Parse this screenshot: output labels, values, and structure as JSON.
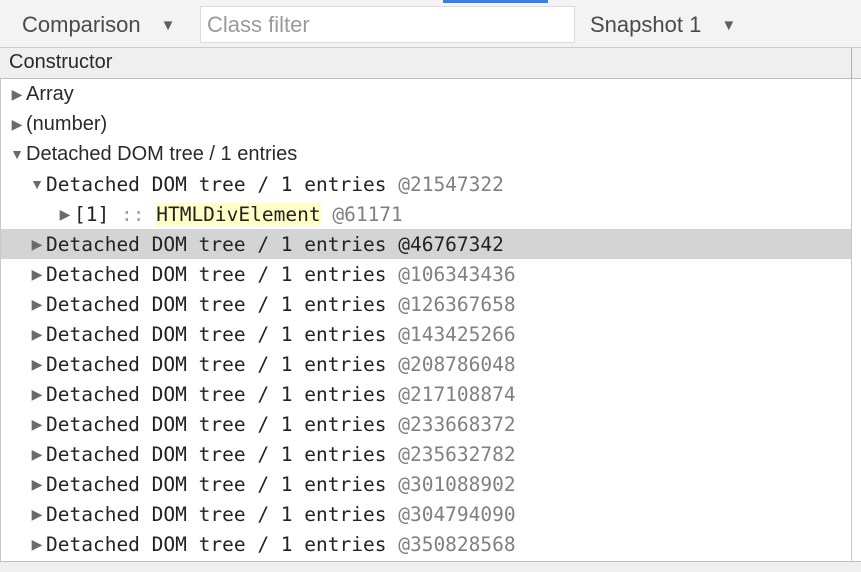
{
  "toolbar": {
    "view_mode": "Comparison",
    "class_filter_placeholder": "Class filter",
    "class_filter_value": "",
    "snapshot": "Snapshot 1",
    "caret": "▼"
  },
  "table": {
    "column_header": "Constructor"
  },
  "glyphs": {
    "collapsed": "▶",
    "expanded": "▼"
  },
  "tree": {
    "top_level": [
      {
        "label": "Array",
        "expanded": false
      },
      {
        "label": "(number)",
        "expanded": false
      },
      {
        "label": "Detached DOM tree / 1 entries",
        "expanded": true
      }
    ],
    "expanded_child": {
      "label": "Detached DOM tree / 1 entries",
      "address": "@21547322",
      "child": {
        "index": "[1]",
        "separator": "::",
        "name": "HTMLDivElement",
        "address": "@61171"
      }
    },
    "children": [
      {
        "label": "Detached DOM tree / 1 entries",
        "address": "@46767342",
        "selected": true
      },
      {
        "label": "Detached DOM tree / 1 entries",
        "address": "@106343436"
      },
      {
        "label": "Detached DOM tree / 1 entries",
        "address": "@126367658"
      },
      {
        "label": "Detached DOM tree / 1 entries",
        "address": "@143425266"
      },
      {
        "label": "Detached DOM tree / 1 entries",
        "address": "@208786048"
      },
      {
        "label": "Detached DOM tree / 1 entries",
        "address": "@217108874"
      },
      {
        "label": "Detached DOM tree / 1 entries",
        "address": "@233668372"
      },
      {
        "label": "Detached DOM tree / 1 entries",
        "address": "@235632782"
      },
      {
        "label": "Detached DOM tree / 1 entries",
        "address": "@301088902"
      },
      {
        "label": "Detached DOM tree / 1 entries",
        "address": "@304794090"
      },
      {
        "label": "Detached DOM tree / 1 entries",
        "address": "@350828568"
      }
    ]
  }
}
